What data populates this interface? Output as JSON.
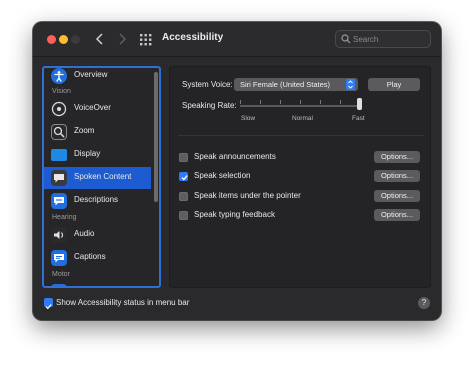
{
  "window": {
    "title": "Accessibility"
  },
  "search": {
    "placeholder": "Search"
  },
  "sidebar": {
    "sections": [
      "Vision",
      "Hearing",
      "Motor"
    ],
    "items": [
      {
        "label": "Overview",
        "icon": "accessibility-icon",
        "color": "#1f6fe0"
      },
      {
        "label": "VoiceOver",
        "icon": "voiceover-icon",
        "color": "#2a2a2c"
      },
      {
        "label": "Zoom",
        "icon": "zoom-icon",
        "color": "#2a2a2c"
      },
      {
        "label": "Display",
        "icon": "display-icon",
        "color": "#1e88e5"
      },
      {
        "label": "Spoken Content",
        "icon": "speech-bubble-icon",
        "color": "#3b3b3e"
      },
      {
        "label": "Descriptions",
        "icon": "descriptions-icon",
        "color": "#1f6fe0"
      },
      {
        "label": "Audio",
        "icon": "speaker-icon",
        "color": "#2a2a2c"
      },
      {
        "label": "Captions",
        "icon": "captions-icon",
        "color": "#1f6fe0"
      }
    ],
    "selected": "Spoken Content"
  },
  "panel": {
    "system_voice_label": "System Voice:",
    "system_voice_value": "Siri Female (United States)",
    "play_label": "Play",
    "speaking_rate_label": "Speaking Rate:",
    "rate_slow": "Slow",
    "rate_normal": "Normal",
    "rate_fast": "Fast",
    "rate_value": 1.0,
    "options": [
      {
        "label": "Speak announcements",
        "checked": false,
        "button": "Options..."
      },
      {
        "label": "Speak selection",
        "checked": true,
        "button": "Options..."
      },
      {
        "label": "Speak items under the pointer",
        "checked": false,
        "button": "Options..."
      },
      {
        "label": "Speak typing feedback",
        "checked": false,
        "button": "Options..."
      }
    ]
  },
  "footer": {
    "status_label": "Show Accessibility status in menu bar",
    "status_checked": true,
    "help_label": "?"
  },
  "colors": {
    "accent": "#2f7cf6",
    "selection": "#1c5bd0",
    "sidebar_focus": "#2f6fd6"
  }
}
